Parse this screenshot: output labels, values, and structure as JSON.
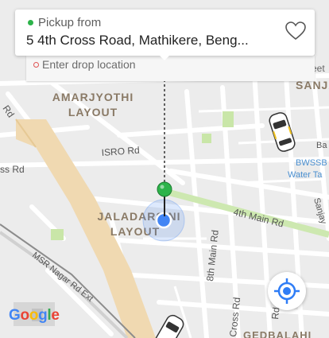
{
  "pickup": {
    "label": "Pickup from",
    "address": "5 4th Cross Road, Mathikere, Beng..."
  },
  "drop": {
    "placeholder": "Enter drop location"
  },
  "map": {
    "labels": {
      "amarjyothi_1": "AMARJYOTHI",
      "amarjyothi_2": "LAYOUT",
      "jaladarshini_1": "JALADARSINI",
      "jaladarshini_2": "LAYOUT",
      "sanja": "SANJA",
      "isro_rd": "ISRO Rd",
      "ss_rd": "ss Rd",
      "rd_left": "Rd",
      "fourth_main": "4th Main Rd",
      "eighth_main": "8th Main Rd",
      "msr_nagar": "MSR Nagar Rd Ext",
      "cross_rd": "Cross Rd",
      "sanjay": "Sanjay",
      "bwssb_1": "BWSSB",
      "bwssb_2": "Water Ta",
      "eet": "eet",
      "ba": "Ba",
      "gerbalahi": "GEDBALAHI",
      "rd_right": "Rd"
    }
  },
  "branding": {
    "google": [
      "G",
      "o",
      "o",
      "g",
      "l",
      "e"
    ]
  },
  "colors": {
    "pickup_green": "#2db34a",
    "location_blue": "#4285f4",
    "primary_road": "#f0d9b1",
    "park": "#c9e6a8",
    "water_label": "#4a8fd0"
  }
}
